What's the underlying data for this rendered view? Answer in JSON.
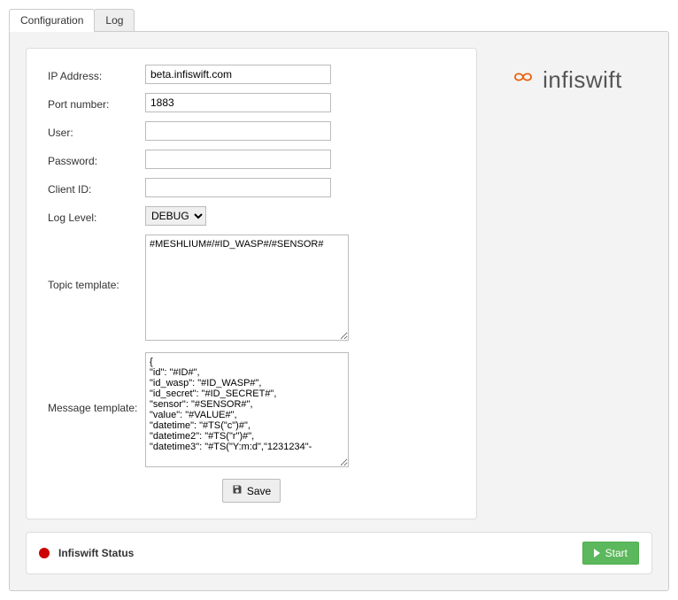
{
  "tabs": {
    "configuration": "Configuration",
    "log": "Log"
  },
  "form": {
    "ip_label": "IP Address:",
    "ip_value": "beta.infiswift.com",
    "port_label": "Port number:",
    "port_value": "1883",
    "user_label": "User:",
    "user_value": "",
    "password_label": "Password:",
    "password_value": "",
    "clientid_label": "Client ID:",
    "clientid_value": "",
    "loglevel_label": "Log Level:",
    "loglevel_value": "DEBUG",
    "topic_label": "Topic template:",
    "topic_value": "#MESHLIUM#/#ID_WASP#/#SENSOR#",
    "msg_label": "Message template:",
    "msg_value": "{\n\"id\": \"#ID#\",\n\"id_wasp\": \"#ID_WASP#\",\n\"id_secret\": \"#ID_SECRET#\",\n\"sensor\": \"#SENSOR#\",\n\"value\": \"#VALUE#\",\n\"datetime\": \"#TS(\"c\")#\",\n\"datetime2\": \"#TS(\"r\")#\",\n\"datetime3\": \"#TS(\"Y:m:d\",\"1231234\"-",
    "save_label": "Save"
  },
  "status": {
    "label": "Infiswift Status",
    "start_label": "Start"
  },
  "brand": {
    "name": "infiswift"
  }
}
